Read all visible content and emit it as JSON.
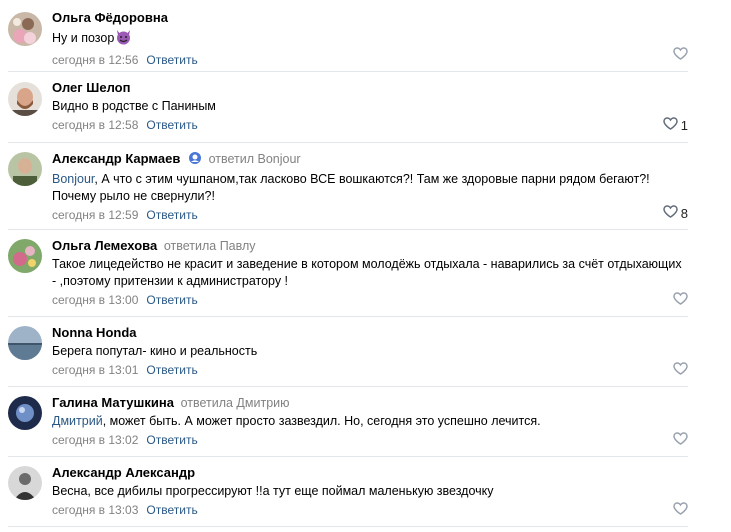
{
  "reply_label": "Ответить",
  "comments": [
    {
      "author": "Ольга Фёдоровна",
      "reply_to": "",
      "mention": "",
      "text": "Ну и позор",
      "time": "сегодня в 12:56",
      "likes": ""
    },
    {
      "author": "Олег Шелоп",
      "reply_to": "",
      "mention": "",
      "text": "Видно в родстве с Паниным",
      "time": "сегодня в 12:58",
      "likes": "1"
    },
    {
      "author": "Александр Кармаев",
      "reply_to": "ответил Bonjour",
      "mention": "Bonjour",
      "text": ", А что с этим чушпаном,так ласково ВСЕ вошкаются?! Там же здоровые парни рядом бегают?! Почему рыло не свернули?!",
      "time": "сегодня в 12:59",
      "likes": "8"
    },
    {
      "author": "Ольга Лемехова",
      "reply_to": "ответила Павлу",
      "mention": "",
      "text": "Такое лицедейство не красит и заведение в котором молодёжь отдыхала - наварились за счёт отдыхающих - ,поэтому притензии к администратору !",
      "time": "сегодня в 13:00",
      "likes": ""
    },
    {
      "author": "Nonna Honda",
      "reply_to": "",
      "mention": "",
      "text": "Берега попутал- кино и реальность",
      "time": "сегодня в 13:01",
      "likes": ""
    },
    {
      "author": "Галина Матушкина",
      "reply_to": "ответила Дмитрию",
      "mention": "Дмитрий",
      "text": ", может быть. А может просто зазвездил. Но, сегодня это успешно лечится.",
      "time": "сегодня в 13:02",
      "likes": ""
    },
    {
      "author": "Александр Александр",
      "reply_to": "",
      "mention": "",
      "text": "Весна, все дибилы прогрессируют !!а тут еще поймал маленькую звездочку",
      "time": "сегодня в 13:03",
      "likes": ""
    }
  ]
}
